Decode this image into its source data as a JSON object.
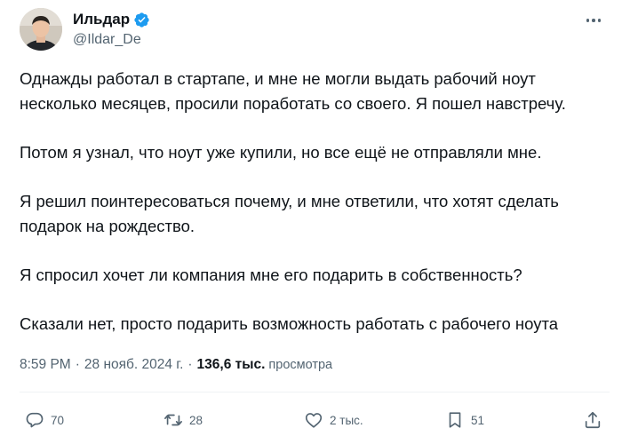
{
  "author": {
    "name": "Ильдар",
    "handle": "@Ildar_De",
    "verified": true
  },
  "tweet": {
    "paragraphs": [
      "Однажды работал в стартапе, и мне не могли выдать рабочий ноут несколько месяцев, просили поработать со своего. Я пошел навстречу.",
      "Потом я узнал, что ноут уже купили, но все ещё не отправляли мне.",
      "Я решил поинтересоваться почему, и мне ответили, что хотят сделать подарок на рождество.",
      "Я спросил хочет ли компания мне его подарить в собственность?",
      "Сказали нет, просто подарить возможность работать с рабочего ноута"
    ]
  },
  "meta": {
    "time": "8:59 PM",
    "separator": "·",
    "date": "28 нояб. 2024 г.",
    "views_count": "136,6 тыс.",
    "views_label": "просмотра"
  },
  "actions": {
    "replies": "70",
    "retweets": "28",
    "likes": "2 тыс.",
    "bookmarks": "51"
  },
  "icons": {
    "reply": "reply-bubble-icon",
    "retweet": "retweet-icon",
    "like": "heart-icon",
    "bookmark": "bookmark-icon",
    "share": "share-upload-icon",
    "more": "more-dots-icon",
    "verified": "verified-badge-icon"
  },
  "colors": {
    "text": "#0f1419",
    "secondary": "#536471",
    "verified": "#1d9bf0",
    "divider": "#eff3f4"
  }
}
